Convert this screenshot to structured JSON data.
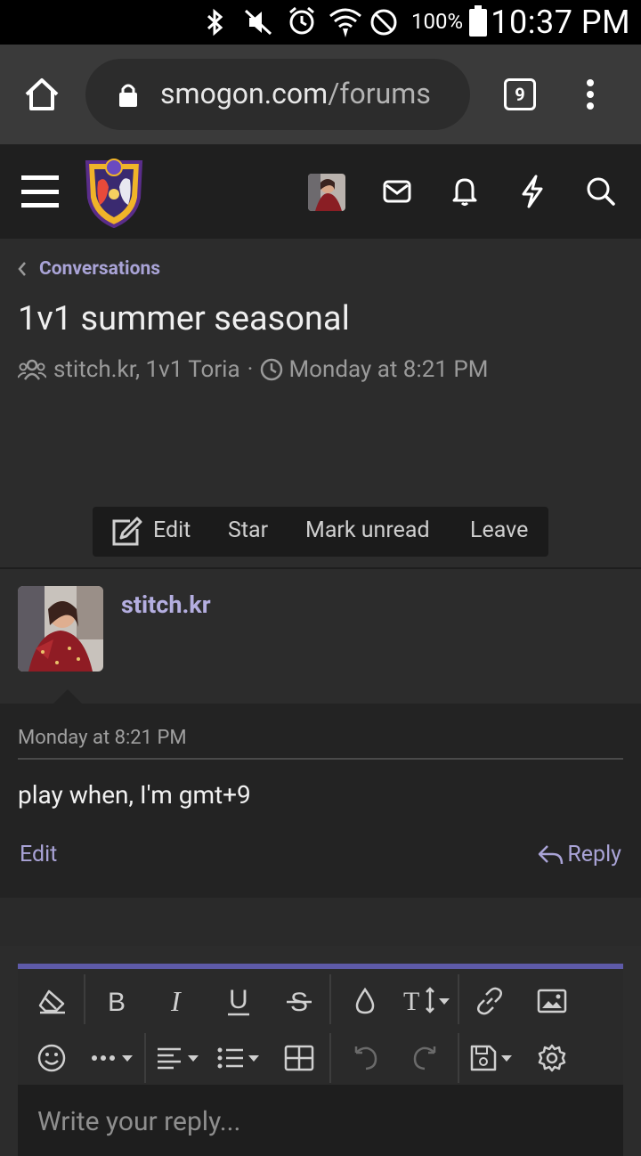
{
  "status_bar": {
    "battery": "100%",
    "time": "10:37 PM"
  },
  "browser": {
    "domain": "smogon.com",
    "path": "/forums",
    "tab_count": "9"
  },
  "breadcrumb": {
    "label": "Conversations"
  },
  "conversation": {
    "title": "1v1 summer seasonal",
    "participants": "stitch.kr, 1v1 Toria",
    "separator": "·",
    "started": "Monday at 8:21 PM"
  },
  "actions": {
    "edit": "Edit",
    "star": "Star",
    "mark_unread": "Mark unread",
    "leave": "Leave"
  },
  "message": {
    "author": "stitch.kr",
    "time": "Monday at 8:21 PM",
    "body": "play when, I'm gmt+9",
    "edit_label": "Edit",
    "reply_label": "Reply"
  },
  "editor": {
    "placeholder": "Write your reply..."
  },
  "colors": {
    "accent": "#a9a3d6",
    "editor_border": "#5e5aa8"
  }
}
